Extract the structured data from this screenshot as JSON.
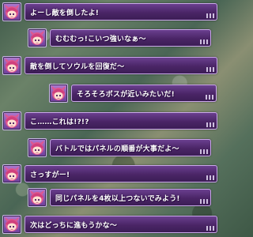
{
  "messages": [
    {
      "text": "よーし敵を倒したよ!"
    },
    {
      "text": "むむむっ!こいつ強いなぁ～"
    },
    {
      "text": "敵を倒してソウルを回復だ～"
    },
    {
      "text": "そろそろボスが近いみたいだ!"
    },
    {
      "text": "こ……これは!?!?"
    },
    {
      "text": "バトルではパネルの順番が大事だよ～"
    },
    {
      "text": "さっすがー!"
    },
    {
      "text": "同じパネルを4枚以上つないでみよう!"
    },
    {
      "text": "次はどっちに進もうかな～"
    }
  ]
}
